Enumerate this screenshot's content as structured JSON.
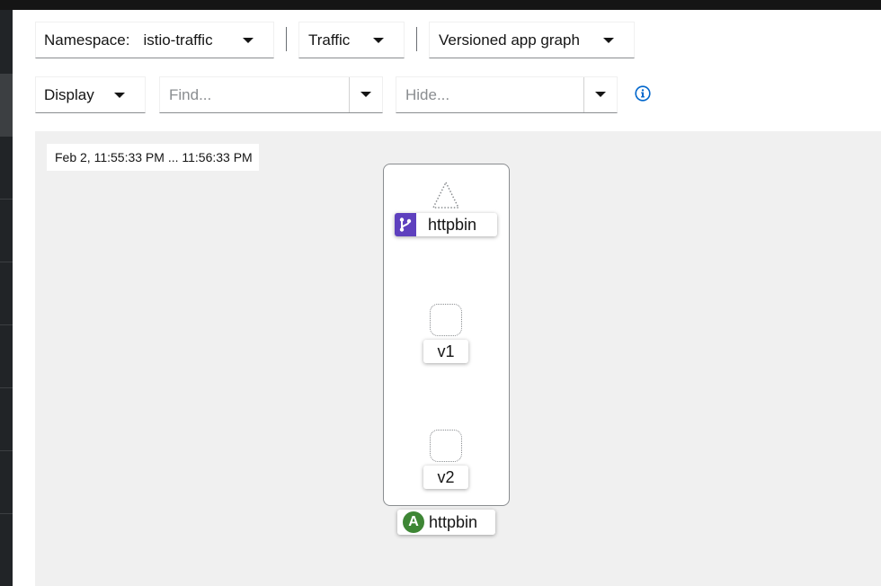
{
  "toolbar": {
    "namespace": {
      "label": "Namespace:",
      "value": "istio-traffic"
    },
    "traffic": {
      "label": "Traffic"
    },
    "graph_type": {
      "label": "Versioned app graph"
    },
    "display": {
      "label": "Display"
    },
    "find": {
      "placeholder": "Find..."
    },
    "hide": {
      "placeholder": "Hide..."
    }
  },
  "graph": {
    "timestamp": "Feb 2, 11:55:33 PM ... 11:56:33 PM",
    "app_box": {
      "label": "httpbin",
      "badge": "A"
    },
    "service_node": {
      "label": "httpbin"
    },
    "workloads": [
      {
        "label": "v1"
      },
      {
        "label": "v2"
      }
    ]
  },
  "colors": {
    "service_badge": "#5e40be",
    "app_badge": "#3e8635",
    "info_icon": "#0066cc",
    "canvas_bg": "#f0f0f0"
  }
}
